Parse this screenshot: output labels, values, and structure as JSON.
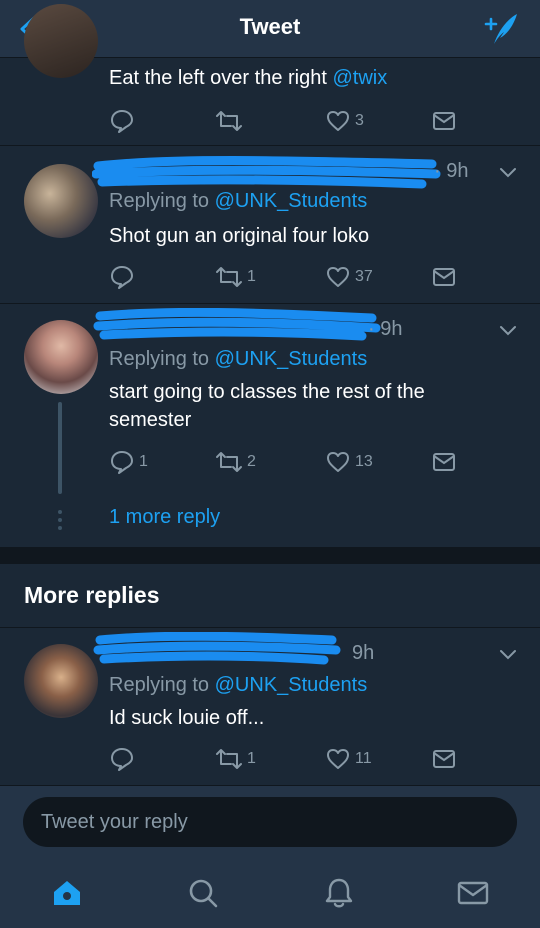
{
  "header": {
    "title": "Tweet",
    "back_icon": "chevron-left-icon",
    "compose_icon": "compose-tweet-icon"
  },
  "tweets": [
    {
      "text_prefix": "Eat the left over the right ",
      "text_handle": "@twix",
      "reply_count": "",
      "retweet_count": "",
      "like_count": "3"
    },
    {
      "meta_time": "· 9h",
      "replying_label": "Replying to",
      "replying_handle": "@UNK_Students",
      "text": "Shot gun an original four loko",
      "reply_count": "",
      "retweet_count": "1",
      "like_count": "37"
    },
    {
      "meta_time": "· 9h",
      "replying_label": "Replying to",
      "replying_handle": "@UNK_Students",
      "text": "start going to classes the rest of the semester",
      "reply_count": "1",
      "retweet_count": "2",
      "like_count": "13",
      "more_reply": "1 more reply"
    },
    {
      "meta_time": "9h",
      "replying_label": "Replying to",
      "replying_handle": "@UNK_Students",
      "text": "Id suck louie off...",
      "reply_count": "",
      "retweet_count": "1",
      "like_count": "11"
    }
  ],
  "section_title": "More replies",
  "composer": {
    "placeholder": "Tweet your reply"
  },
  "tabbar": {
    "items": [
      "home-icon",
      "search-icon",
      "notifications-icon",
      "messages-icon"
    ]
  },
  "colors": {
    "background": "#1b2836",
    "bar": "#243447",
    "accent": "#1da1f2",
    "muted": "#8899a6"
  }
}
